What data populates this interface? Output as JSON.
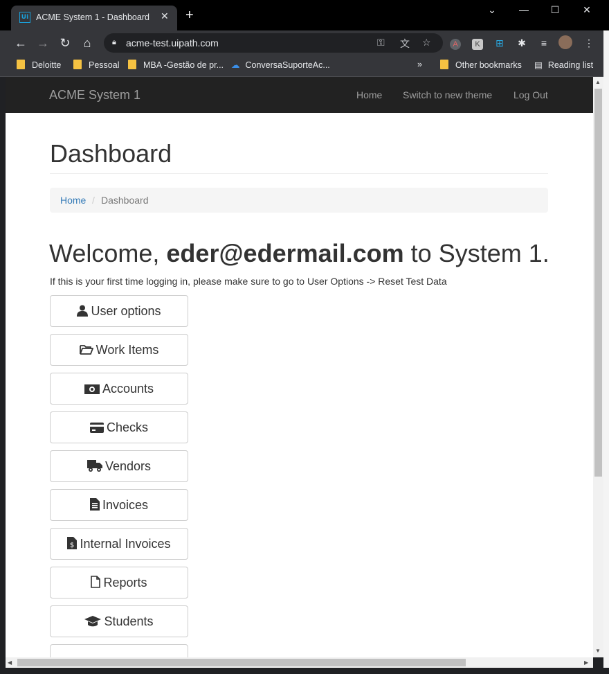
{
  "browser": {
    "tab_title": "ACME System 1 - Dashboard",
    "tab_favicon_text": "Ui",
    "url": "acme-test.uipath.com",
    "bookmarks": [
      "Deloitte",
      "Pessoal",
      "MBA -Gestão de pr...",
      "ConversaSuporteAc..."
    ],
    "more_bookmarks": "»",
    "other_bookmarks": "Other bookmarks",
    "reading_list": "Reading list"
  },
  "navbar": {
    "brand": "ACME System 1",
    "links": [
      "Home",
      "Switch to new theme",
      "Log Out"
    ]
  },
  "page": {
    "title": "Dashboard",
    "breadcrumb": [
      "Home",
      "/",
      "Dashboard"
    ],
    "welcome_prefix": "Welcome,",
    "welcome_user": "eder@edermail.com",
    "welcome_suffix": "to System 1.",
    "note": "If this is your first time logging in, please make sure to go to User Options -> Reset Test Data"
  },
  "menu_buttons": [
    {
      "label": "User options",
      "icon": "user-icon"
    },
    {
      "label": "Work Items",
      "icon": "folder-open-icon"
    },
    {
      "label": "Accounts",
      "icon": "money-icon"
    },
    {
      "label": "Checks",
      "icon": "credit-card-icon"
    },
    {
      "label": "Vendors",
      "icon": "truck-icon"
    },
    {
      "label": "Invoices",
      "icon": "file-text-icon"
    },
    {
      "label": "Internal Invoices",
      "icon": "file-invoice-dollar-icon"
    },
    {
      "label": "Reports",
      "icon": "file-icon"
    },
    {
      "label": "Students",
      "icon": "graduation-cap-icon"
    }
  ],
  "colors": {
    "navbar": "#222222",
    "link": "#337ab7",
    "tab_favicon": "#1a9fd8"
  }
}
